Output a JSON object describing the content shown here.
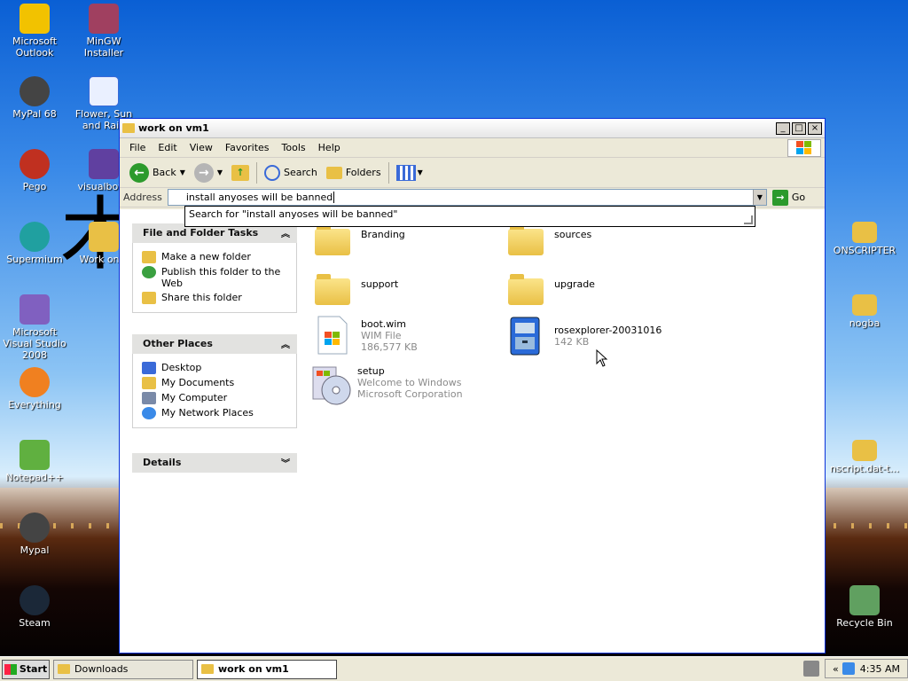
{
  "desktop": {
    "icons_left": [
      {
        "label": "Microsoft Outlook",
        "color": "#f2c200"
      },
      {
        "label": "MinGW Installer",
        "color": "#a04060"
      },
      {
        "label": "MyPal 68",
        "color": "#444"
      },
      {
        "label": "Flower, Sun and Rain",
        "color": "#3a6ad8"
      },
      {
        "label": "Pego",
        "color": "#c03020"
      },
      {
        "label": "visualboya",
        "color": "#6040a0"
      },
      {
        "label": "Supermium",
        "color": "#20a0a0"
      },
      {
        "label": "Work on v",
        "color": "#e9c045"
      },
      {
        "label": "Microsoft Visual Studio 2008",
        "color": "#8060c0"
      },
      {
        "label": "Everything",
        "color": "#f08020"
      },
      {
        "label": "Notepad++",
        "color": "#60b040"
      },
      {
        "label": "Mypal",
        "color": "#444"
      },
      {
        "label": "Steam",
        "color": "#1b2838"
      }
    ],
    "icons_right": [
      {
        "label": "ONSCRIPTER",
        "color": "#e9c045"
      },
      {
        "label": "nogba",
        "color": "#e9c045"
      },
      {
        "label": "nscript.dat-t...",
        "color": "#e9c045"
      },
      {
        "label": "Recycle Bin",
        "color": "#60a060"
      }
    ]
  },
  "window": {
    "title": "work on vm1",
    "controls": {
      "minimize": "_",
      "maximize": "□",
      "close": "×"
    },
    "menu": [
      "File",
      "Edit",
      "View",
      "Favorites",
      "Tools",
      "Help"
    ],
    "toolbar": {
      "back": "Back",
      "search": "Search",
      "folders": "Folders"
    },
    "address": {
      "label": "Address",
      "value": "install anyoses will be banned",
      "go": "Go",
      "suggestion": "Search for \"install anyoses will be banned\""
    },
    "tasks": {
      "file_folder": {
        "title": "File and Folder Tasks",
        "items": [
          "Make a new folder",
          "Publish this folder to the Web",
          "Share this folder"
        ]
      },
      "other_places": {
        "title": "Other Places",
        "items": [
          "Desktop",
          "My Documents",
          "My Computer",
          "My Network Places"
        ]
      },
      "details": {
        "title": "Details"
      }
    },
    "files": [
      {
        "name": "Branding",
        "kind": "folder"
      },
      {
        "name": "sources",
        "kind": "folder"
      },
      {
        "name": "support",
        "kind": "folder"
      },
      {
        "name": "upgrade",
        "kind": "folder"
      },
      {
        "name": "boot.wim",
        "kind": "wim",
        "line2": "WIM File",
        "line3": "186,577 KB"
      },
      {
        "name": "rosexplorer-20031016",
        "kind": "exe",
        "line2": "142 KB"
      },
      {
        "name": "setup",
        "kind": "setup",
        "line2": "Welcome to Windows",
        "line3": "Microsoft Corporation"
      }
    ]
  },
  "taskbar": {
    "start": "Start",
    "buttons": [
      "Downloads",
      "work on vm1"
    ],
    "clock": "4:35 AM",
    "tray_chevron": "«"
  }
}
